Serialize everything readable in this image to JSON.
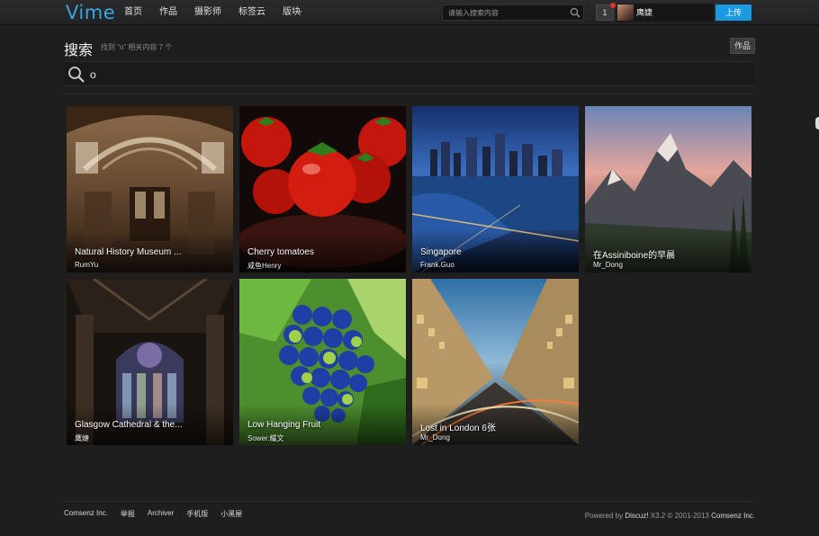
{
  "brand": {
    "logo_text": "Vime",
    "accent_color": "#1b9ae4"
  },
  "nav": {
    "items": [
      "首页",
      "作品",
      "摄影师",
      "标签云",
      "版块"
    ]
  },
  "top_search": {
    "placeholder": "请输入搜索内容",
    "icon": "search-icon"
  },
  "notifications": {
    "count": "1",
    "dot_color": "#e0322b"
  },
  "user": {
    "name": "鹰婕"
  },
  "upload_label": "上传",
  "search_page": {
    "title": "搜索",
    "result_summary": "找到 “o” 相关内容 7 个",
    "category_label": "作品",
    "query": "o"
  },
  "results": [
    {
      "title": "Natural History Museum ...",
      "author": "RumYu"
    },
    {
      "title": "Cherry tomatoes",
      "author": "咸鱼Henry"
    },
    {
      "title": "Singapore",
      "author": "Frank.Guo"
    },
    {
      "title": "在Assiniboine的早晨",
      "author": "Mr_Dong"
    },
    {
      "title": "Glasgow Cathedral & the...",
      "author": "鹰婕"
    },
    {
      "title": "Low Hanging Fruit",
      "author": "Sower.耀文"
    },
    {
      "title": "Lost in London 6张",
      "author": "Mr_Dong"
    }
  ],
  "footer": {
    "links": [
      "Comsenz Inc.",
      "举报",
      "Archiver",
      "手机版",
      "小黑屋"
    ],
    "powered_prefix": "Powered by",
    "powered_product": "Discuz!",
    "powered_version": "X3.2",
    "copyright": "© 2001-2013",
    "company": "Comsenz Inc."
  }
}
